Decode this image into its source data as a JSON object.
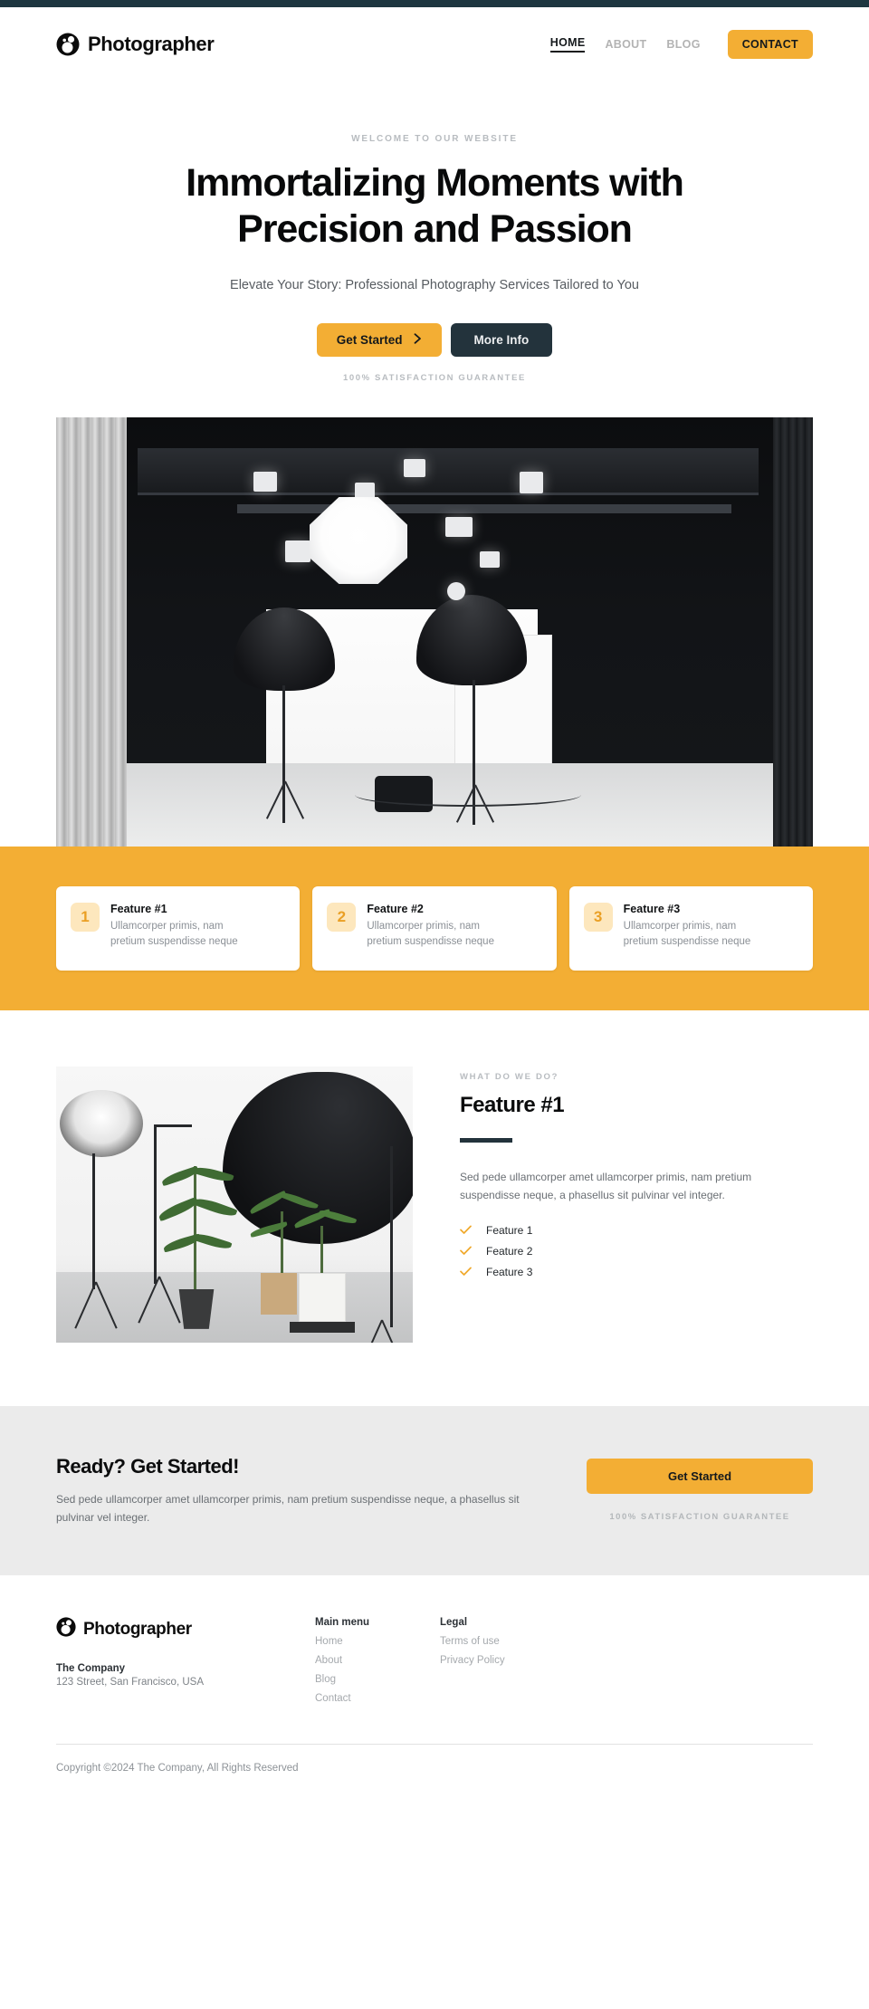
{
  "header": {
    "brand": "Photographer",
    "logo_icon": "camera-aperture-icon",
    "nav": [
      {
        "label": "HOME",
        "active": true
      },
      {
        "label": "ABOUT",
        "active": false
      },
      {
        "label": "BLOG",
        "active": false
      }
    ],
    "contact_label": "CONTACT"
  },
  "hero": {
    "eyebrow": "WELCOME TO OUR WEBSITE",
    "title": "Immortalizing Moments with Precision and Passion",
    "subtitle": "Elevate Your Story: Professional Photography Services Tailored to You",
    "primary_button": "Get Started",
    "primary_button_icon": "chevron-right-icon",
    "secondary_button": "More Info",
    "guarantee": "100% SATISFACTION GUARANTEE",
    "image_alt": "dark-photo-studio-with-lighting-rig"
  },
  "features": {
    "cards": [
      {
        "number": "1",
        "title": "Feature #1",
        "text": "Ullamcorper primis, nam pretium suspendisse neque"
      },
      {
        "number": "2",
        "title": "Feature #2",
        "text": "Ullamcorper primis, nam pretium suspendisse neque"
      },
      {
        "number": "3",
        "title": "Feature #3",
        "text": "Ullamcorper primis, nam pretium suspendisse neque"
      }
    ]
  },
  "about": {
    "eyebrow": "WHAT DO WE DO?",
    "title": "Feature #1",
    "body": "Sed pede ullamcorper amet ullamcorper primis, nam pretium suspendisse neque, a phasellus sit pulvinar vel integer.",
    "checklist": [
      {
        "icon": "check-icon",
        "label": "Feature 1"
      },
      {
        "icon": "check-icon",
        "label": "Feature 2"
      },
      {
        "icon": "check-icon",
        "label": "Feature 3"
      }
    ],
    "image_alt": "bright-white-studio-with-plants-and-softboxes"
  },
  "cta": {
    "title": "Ready? Get Started!",
    "body": "Sed pede ullamcorper amet ullamcorper primis, nam pretium suspendisse neque, a phasellus sit pulvinar vel integer.",
    "button": "Get Started",
    "guarantee": "100% SATISFACTION GUARANTEE"
  },
  "footer": {
    "brand": "Photographer",
    "company": "The Company",
    "address": "123 Street, San Francisco, USA",
    "menu_title": "Main menu",
    "menu_links": [
      "Home",
      "About",
      "Blog",
      "Contact"
    ],
    "legal_title": "Legal",
    "legal_links": [
      "Terms of use",
      "Privacy Policy"
    ],
    "copyright": "Copyright ©2024 The Company, All Rights Reserved"
  },
  "colors": {
    "accent": "#f3ae34",
    "dark": "#23333c",
    "band": "#f3ae34",
    "cta_bg": "#ebebeb",
    "muted": "#8b9096"
  }
}
